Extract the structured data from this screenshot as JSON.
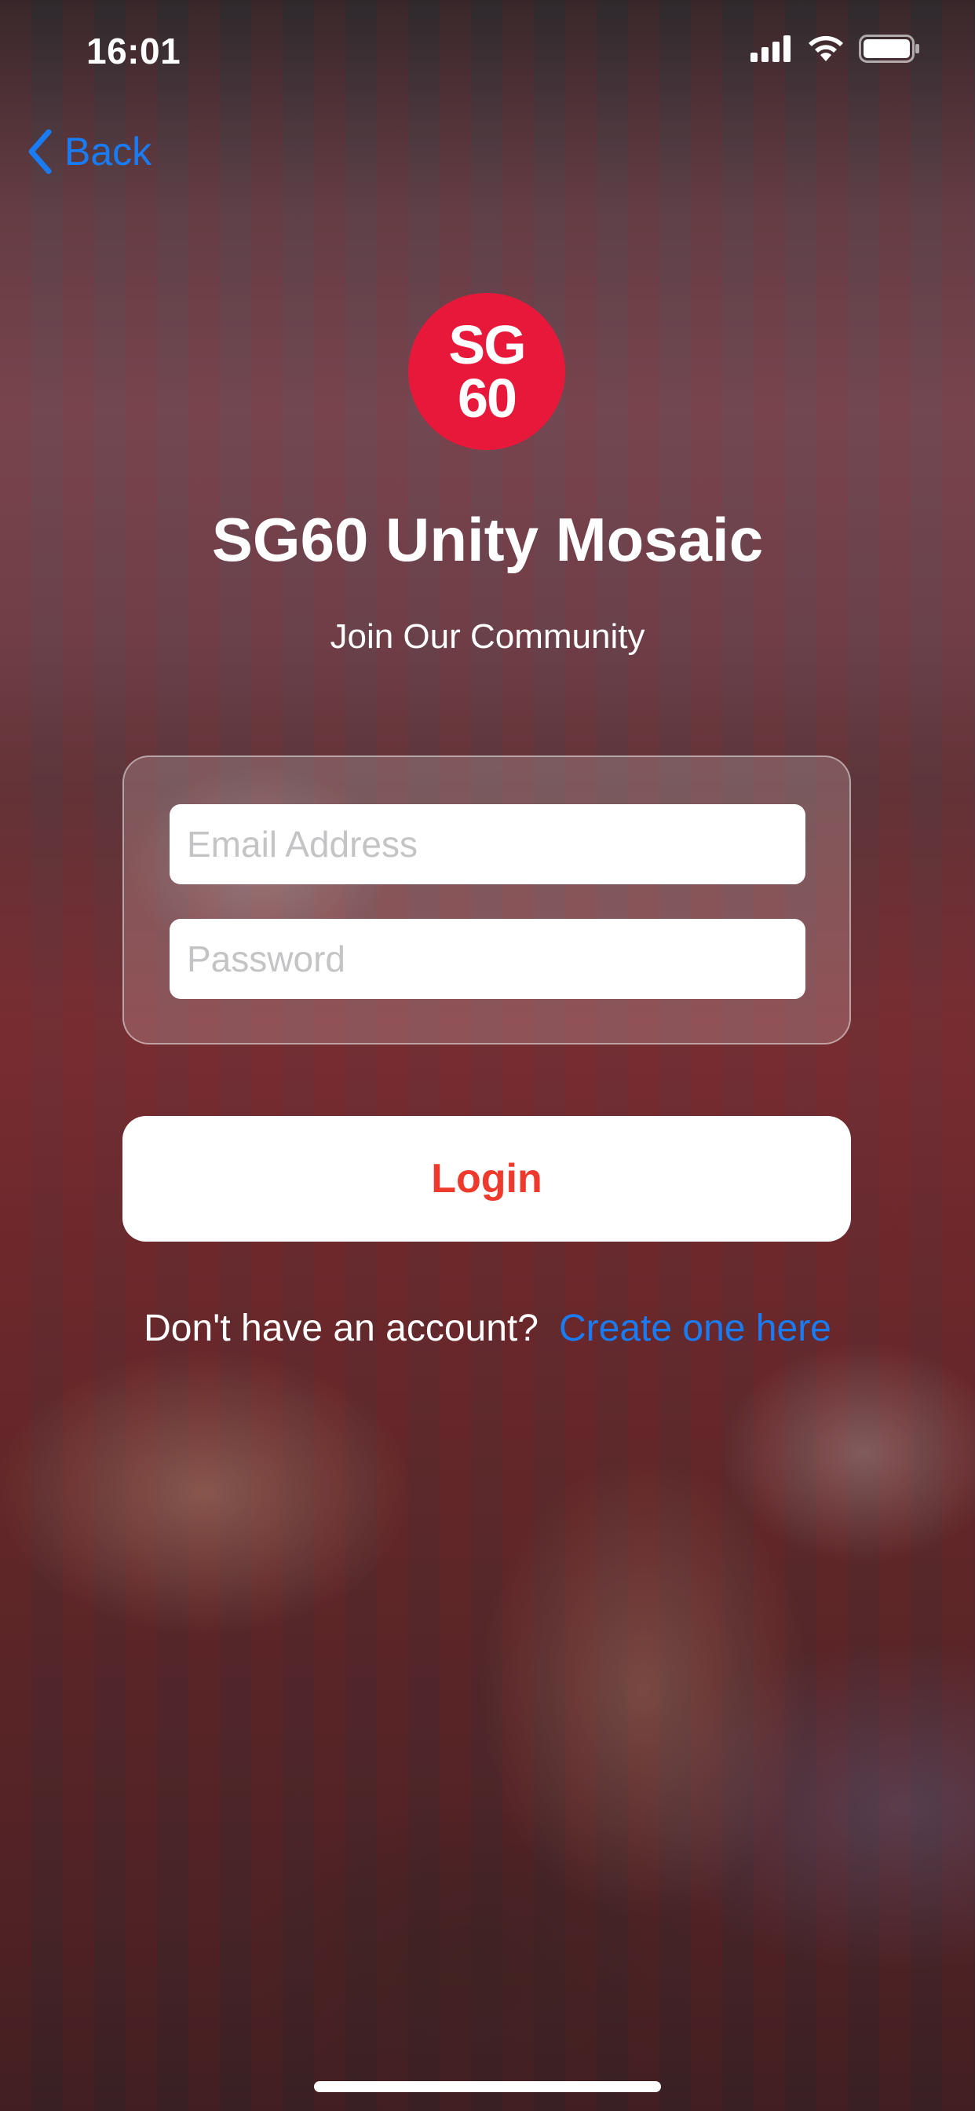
{
  "status_bar": {
    "time": "16:01",
    "icons": [
      "cellular-signal-icon",
      "wifi-icon",
      "battery-icon"
    ]
  },
  "nav": {
    "back_label": "Back",
    "back_icon": "chevron-left-icon"
  },
  "logo": {
    "line1": "SG",
    "line2": "60",
    "color": "#e8183a"
  },
  "header": {
    "title": "SG60 Unity Mosaic",
    "subtitle": "Join Our Community"
  },
  "form": {
    "email_placeholder": "Email Address",
    "email_value": "",
    "password_placeholder": "Password",
    "password_value": ""
  },
  "actions": {
    "login_label": "Login",
    "login_color": "#ee3a2c"
  },
  "signup": {
    "prompt": "Don't have an account?",
    "link_label": "Create one here",
    "link_color": "#1a7cf5"
  }
}
